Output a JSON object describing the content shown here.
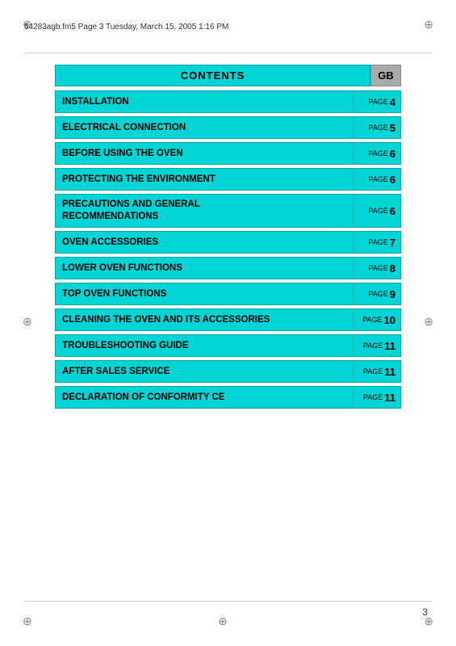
{
  "header": {
    "text": "54283agb.fm5  Page 3  Tuesday, March 15, 2005  1:16 PM"
  },
  "contents_title": "CONTENTS",
  "gb_label": "GB",
  "toc": [
    {
      "label": "INSTALLATION",
      "page_word": "PAGE",
      "page_num": "4"
    },
    {
      "label": "ELECTRICAL CONNECTION",
      "page_word": "PAGE",
      "page_num": "5"
    },
    {
      "label": "BEFORE USING THE OVEN",
      "page_word": "PAGE",
      "page_num": "6"
    },
    {
      "label": "PROTECTING THE ENVIRONMENT",
      "page_word": "PAGE",
      "page_num": "6"
    },
    {
      "label": "PRECAUTIONS AND GENERAL\nRECOMMENDATIONS",
      "page_word": "PAGE",
      "page_num": "6",
      "tall": true
    },
    {
      "label": "OVEN ACCESSORIES",
      "page_word": "PAGE",
      "page_num": "7"
    },
    {
      "label": "LOWER OVEN FUNCTIONS",
      "page_word": "PAGE",
      "page_num": "8"
    },
    {
      "label": "TOP OVEN FUNCTIONS",
      "page_word": "PAGE",
      "page_num": "9"
    },
    {
      "label": "CLEANING THE OVEN AND ITS ACCESSORIES",
      "page_word": "PAGE",
      "page_num": "10"
    },
    {
      "label": "TROUBLESHOOTING GUIDE",
      "page_word": "PAGE",
      "page_num": "11"
    },
    {
      "label": "AFTER SALES SERVICE",
      "page_word": "PAGE",
      "page_num": "11"
    },
    {
      "label": "DECLARATION OF CONFORMITY CE",
      "page_word": "PAGE",
      "page_num": "11"
    }
  ],
  "page_number": "3"
}
